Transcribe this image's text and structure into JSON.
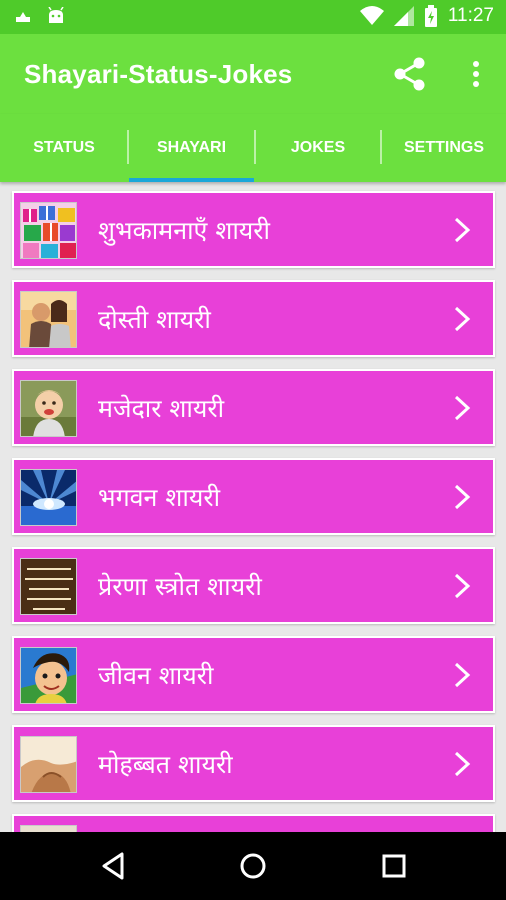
{
  "status_bar": {
    "time": "11:27"
  },
  "app_bar": {
    "title": "Shayari-Status-Jokes"
  },
  "tabs": [
    {
      "label": "STATUS",
      "active": false
    },
    {
      "label": "SHAYARI",
      "active": true
    },
    {
      "label": "JOKES",
      "active": false
    },
    {
      "label": "SETTINGS",
      "active": false
    }
  ],
  "list": {
    "items": [
      {
        "label": "शुभकामनाएँ शायरी",
        "thumb": "gifts-icon"
      },
      {
        "label": "दोस्ती शायरी",
        "thumb": "couple-photo"
      },
      {
        "label": "मजेदार शायरी",
        "thumb": "baby-photo"
      },
      {
        "label": "भगवन शायरी",
        "thumb": "light-rays-photo"
      },
      {
        "label": "प्रेरणा स्त्रोत शायरी",
        "thumb": "quote-card-photo"
      },
      {
        "label": "जीवन शायरी",
        "thumb": "cartoon-face-icon"
      },
      {
        "label": "मोहब्बत शायरी",
        "thumb": "hands-photo"
      }
    ]
  },
  "colors": {
    "status_bar": "#4fcb2a",
    "app_bar": "#6ce03f",
    "tab_indicator": "#1aa7d8",
    "row_bg": "#e840d8",
    "list_bg": "#e8e8e8"
  }
}
